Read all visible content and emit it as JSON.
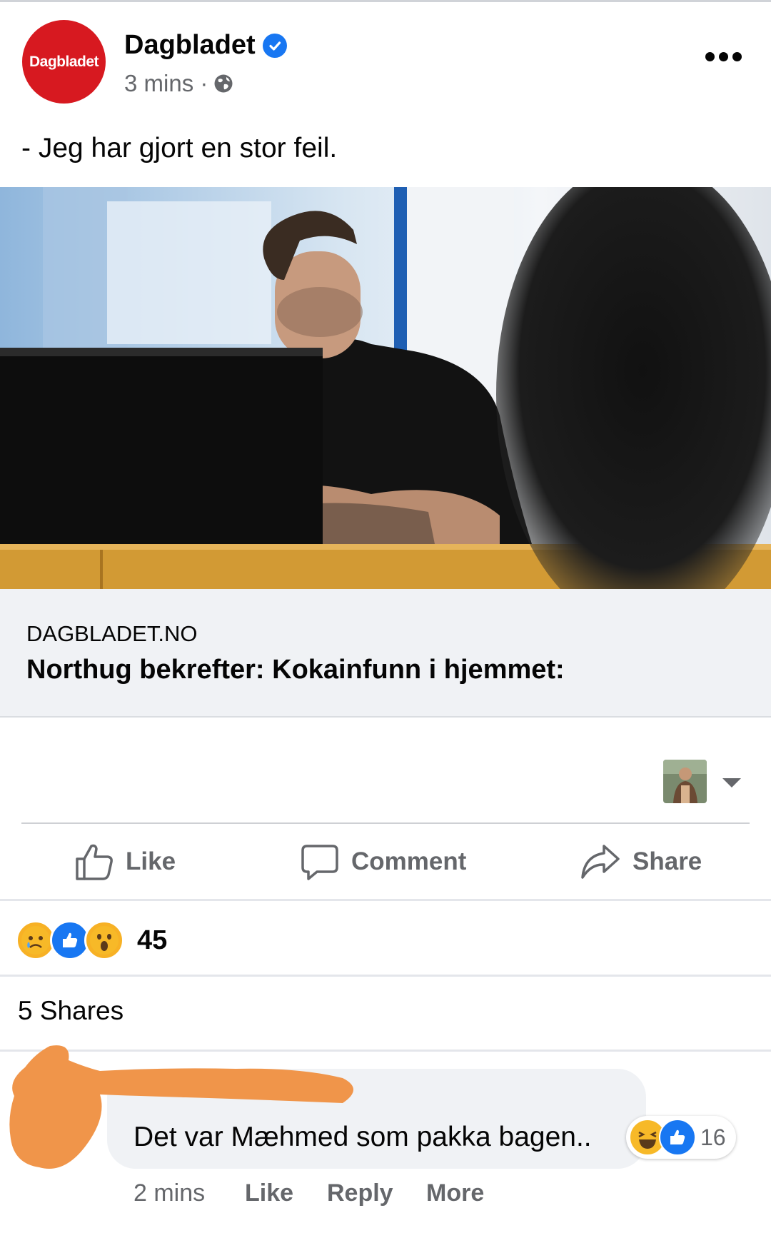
{
  "post": {
    "page_name": "Dagbladet",
    "avatar_text": "Dagbladet",
    "time": "3 mins ·",
    "text": "- Jeg har gjort en stor feil.",
    "icons": {
      "verified": "verified-badge-icon",
      "privacy": "globe-icon",
      "menu": "more-options-icon"
    }
  },
  "link": {
    "domain": "DAGBLADET.NO",
    "headline": "Northug bekrefter: Kokainfunn i hjemmet:"
  },
  "actions": {
    "like": "Like",
    "comment": "Comment",
    "share": "Share"
  },
  "stats": {
    "reaction_count": "45",
    "reactions": [
      "sad",
      "like",
      "wow"
    ],
    "shares": "5 Shares"
  },
  "comment": {
    "text": "Det var Mæhmed som pakka bagen..",
    "reaction_count": "16",
    "reactions": [
      "haha",
      "like"
    ],
    "time": "2 mins",
    "like": "Like",
    "reply": "Reply",
    "more": "More"
  },
  "colors": {
    "brand_red": "#d71920",
    "facebook_blue": "#1877f2",
    "secondary_text": "#65676b",
    "scribble": "#f0954a"
  }
}
